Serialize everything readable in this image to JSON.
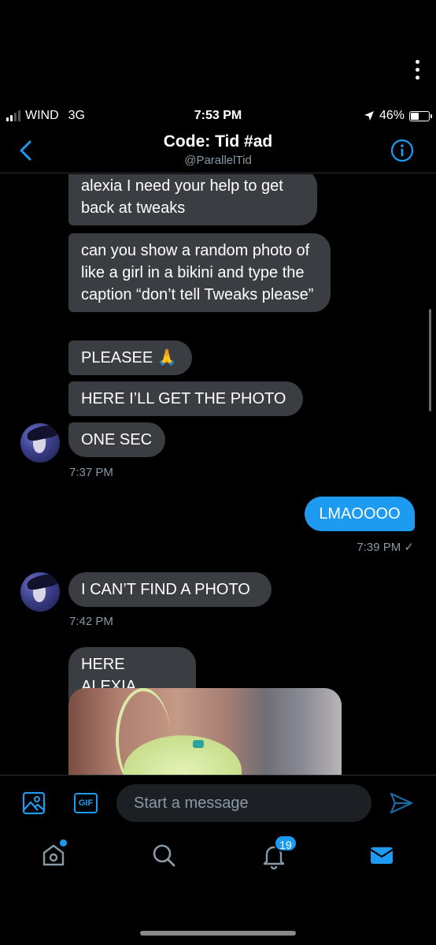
{
  "status_bar": {
    "carrier": "WIND",
    "network": "3G",
    "time": "7:53 PM",
    "battery": "46%",
    "battery_level": 0.46
  },
  "header": {
    "title": "Code: Tid #ad",
    "handle": "@ParallelTid"
  },
  "messages": [
    {
      "text": "alexia I need your help to get back at tweaks",
      "direction": "incoming"
    },
    {
      "text": "can you show a random photo of like a girl in a bikini and type the caption “don’t tell Tweaks please”",
      "direction": "incoming"
    },
    {
      "text": "PLEASEE 🙏",
      "direction": "incoming"
    },
    {
      "text": "HERE I’LL GET THE PHOTO",
      "direction": "incoming"
    },
    {
      "text": "ONE SEC",
      "direction": "incoming"
    },
    {
      "text": "LMAOOOO",
      "direction": "outgoing"
    },
    {
      "text": "I CAN’T FIND A PHOTO",
      "direction": "incoming"
    },
    {
      "text": "HERE ALEXIA",
      "direction": "incoming"
    }
  ],
  "timestamps": {
    "t1": "7:37 PM",
    "t2": "7:39 PM ✓",
    "t3": "7:42 PM"
  },
  "composer": {
    "gif_label": "GIF",
    "placeholder": "Start a message"
  },
  "tabbar": {
    "notification_count": "19"
  },
  "colors": {
    "accent": "#1d9bf0",
    "incoming_bubble": "#3a3d41",
    "background": "#000000",
    "secondary_text": "#8899a6"
  }
}
